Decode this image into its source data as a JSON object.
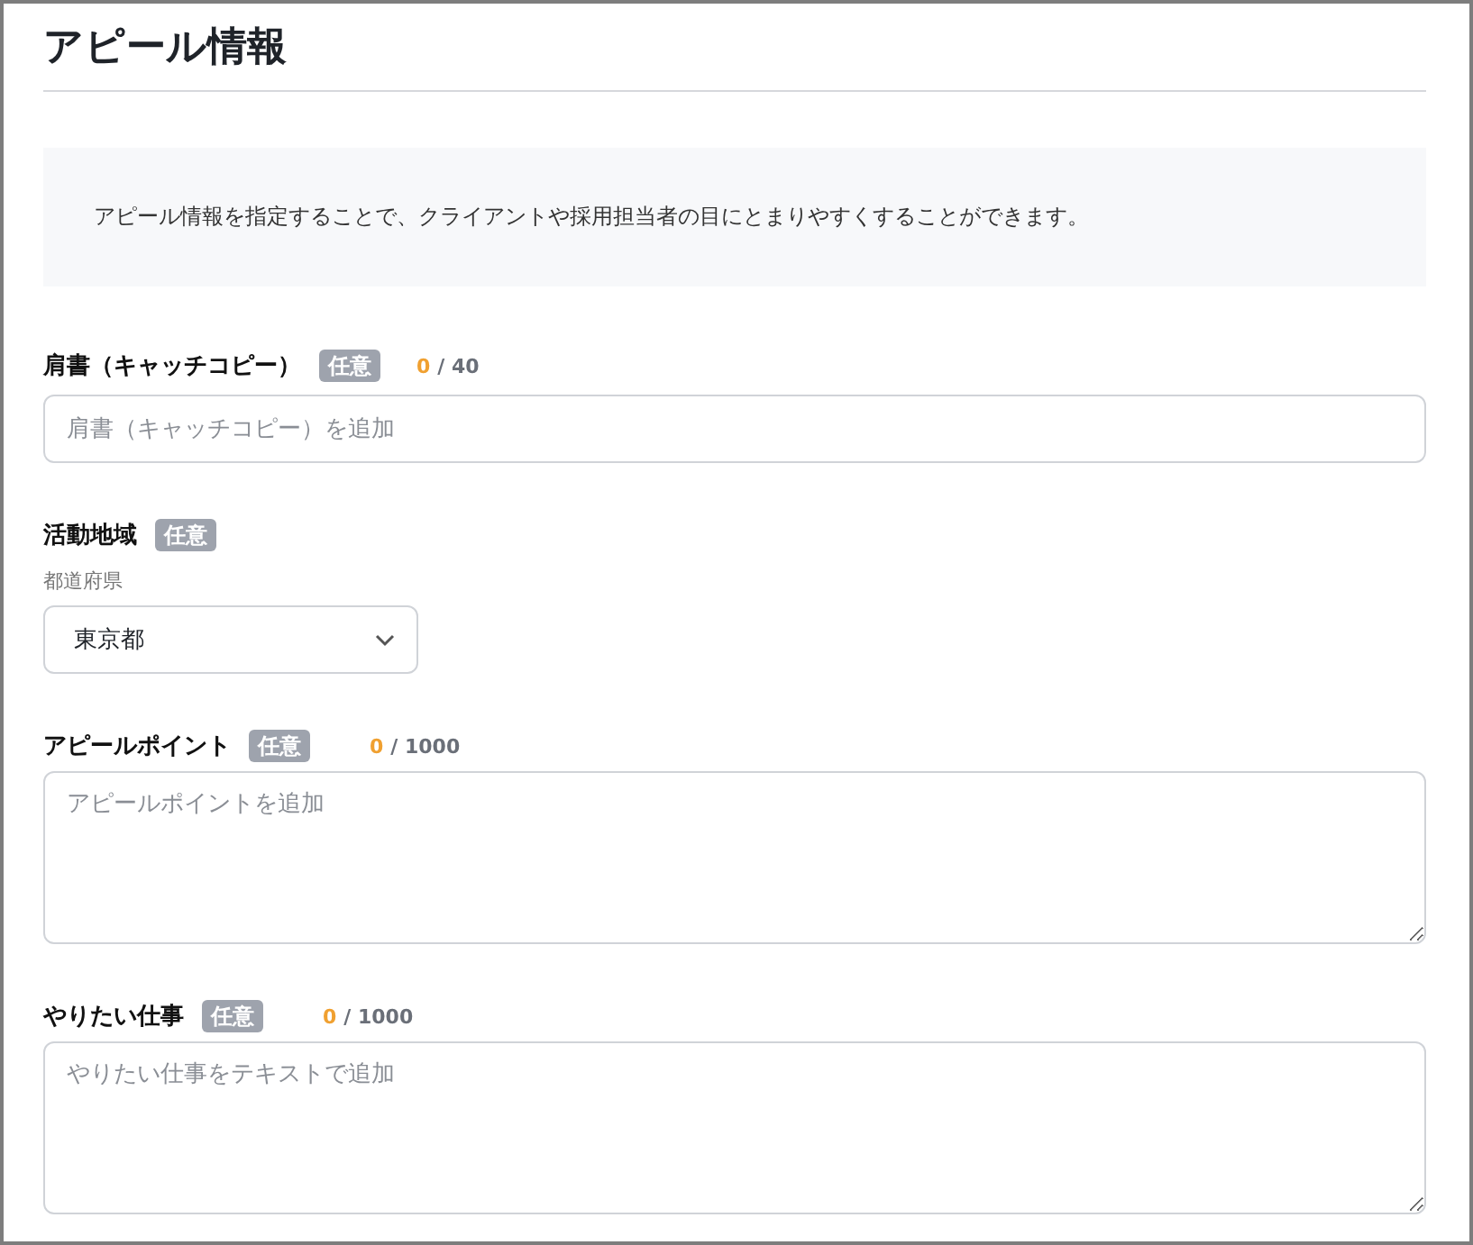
{
  "title": "アピール情報",
  "notice": "アピール情報を指定することで、クライアントや採用担当者の目にとまりやすくすることができます。",
  "fields": [
    {
      "kind": "text",
      "label": "肩書（キャッチコピー）",
      "badge": "任意",
      "count": "0",
      "limit": "/ 40",
      "placeholder": "肩書（キャッチコピー）を追加"
    },
    {
      "kind": "select",
      "label": "活動地域",
      "badge": "任意",
      "sublabel": "都道府県",
      "value": "東京都"
    },
    {
      "kind": "textarea",
      "label": "アピールポイント",
      "badge": "任意",
      "count": "0",
      "limit": "/ 1000",
      "placeholder": "アピールポイントを追加"
    },
    {
      "kind": "textarea",
      "label": "やりたい仕事",
      "badge": "任意",
      "count": "0",
      "limit": "/ 1000",
      "placeholder": "やりたい仕事をテキストで追加"
    }
  ]
}
